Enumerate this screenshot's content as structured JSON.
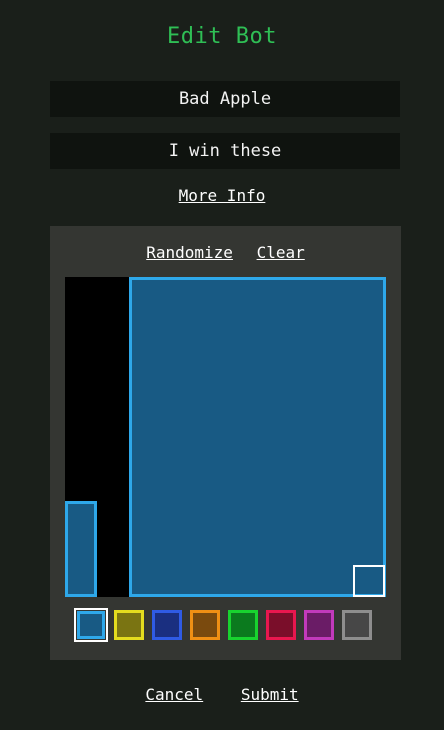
{
  "title": "Edit Bot",
  "form": {
    "name_value": "Bad Apple",
    "description_value": "I win these"
  },
  "more_info_label": "More Info",
  "editor": {
    "randomize_label": "Randomize",
    "clear_label": "Clear",
    "palette": [
      {
        "name": "blue",
        "fill": "#185a84",
        "border": "#2ea8ea",
        "selected": true
      },
      {
        "name": "yellow",
        "fill": "#7a7412",
        "border": "#e4dc1e",
        "selected": false
      },
      {
        "name": "navy",
        "fill": "#1a2f80",
        "border": "#2f5be4",
        "selected": false
      },
      {
        "name": "orange",
        "fill": "#7a4a0e",
        "border": "#f08f14",
        "selected": false
      },
      {
        "name": "green",
        "fill": "#0b7a1e",
        "border": "#18d32f",
        "selected": false
      },
      {
        "name": "red",
        "fill": "#7a0e2a",
        "border": "#e8174f",
        "selected": false
      },
      {
        "name": "purple",
        "fill": "#6a1c66",
        "border": "#c13abb",
        "selected": false
      },
      {
        "name": "gray",
        "fill": "#474747",
        "border": "#8e8e8e",
        "selected": false
      }
    ]
  },
  "actions": {
    "cancel_label": "Cancel",
    "submit_label": "Submit"
  },
  "colors": {
    "title": "#2fbf55",
    "background": "#1a1f1a",
    "panel": "#343632",
    "block_fill": "#185a84",
    "block_border": "#2ea8ea"
  }
}
